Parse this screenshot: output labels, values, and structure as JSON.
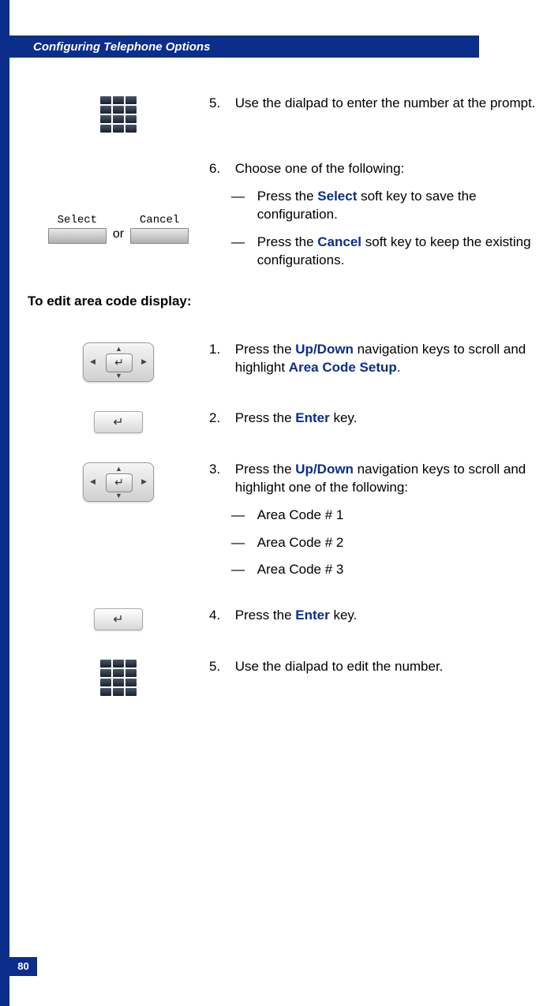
{
  "header": {
    "title": "Configuring Telephone Options"
  },
  "page_number": "80",
  "softkeys": {
    "select_label": "Select",
    "cancel_label": "Cancel",
    "or_text": "or"
  },
  "section1": {
    "step5": {
      "num": "5.",
      "text": "Use the dialpad to enter the number at the prompt."
    },
    "step6": {
      "num": "6.",
      "intro": "Choose one of the following:",
      "opt1_pre": "Press the ",
      "opt1_key": "Select",
      "opt1_post": " soft key to save the configuration.",
      "opt2_pre": "Press the ",
      "opt2_key": "Cancel",
      "opt2_post": " soft key to keep the existing configurations."
    }
  },
  "heading2": "To edit area code display:",
  "section2": {
    "step1": {
      "num": "1.",
      "pre": "Press the ",
      "key": "Up/Down",
      "mid": " navigation keys to scroll and highlight ",
      "target": "Area Code Setup",
      "post": "."
    },
    "step2": {
      "num": "2.",
      "pre": "Press the ",
      "key": "Enter",
      "post": " key."
    },
    "step3": {
      "num": "3.",
      "pre": "Press the ",
      "key": "Up/Down",
      "post": " navigation keys to scroll and highlight one of the following:",
      "items": [
        "Area Code # 1",
        "Area Code # 2",
        "Area Code # 3"
      ]
    },
    "step4": {
      "num": "4.",
      "pre": "Press the ",
      "key": "Enter",
      "post": " key."
    },
    "step5": {
      "num": "5.",
      "text": "Use the dialpad to edit the number."
    }
  },
  "dash": "—"
}
